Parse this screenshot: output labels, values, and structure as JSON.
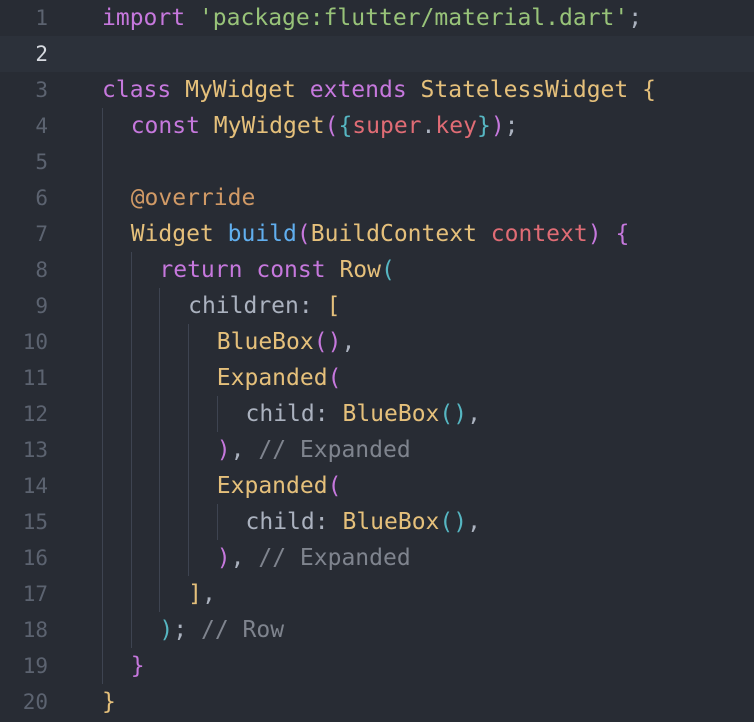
{
  "editor": {
    "lines": [
      {
        "num": "1",
        "t": [
          "import",
          " ",
          "'package:flutter/material.dart'",
          ";"
        ]
      },
      {
        "num": "2",
        "t": []
      },
      {
        "num": "3",
        "t": [
          "class",
          " ",
          "MyWidget",
          " ",
          "extends",
          " ",
          "StatelessWidget",
          " ",
          "{"
        ]
      },
      {
        "num": "4",
        "t": [
          "const",
          " ",
          "MyWidget",
          "(",
          "{",
          "super",
          ".",
          "key",
          "}",
          ")",
          ";"
        ]
      },
      {
        "num": "5",
        "t": []
      },
      {
        "num": "6",
        "t": [
          "@override"
        ]
      },
      {
        "num": "7",
        "t": [
          "Widget",
          " ",
          "build",
          "(",
          "BuildContext",
          " ",
          "context",
          ")",
          " ",
          "{"
        ]
      },
      {
        "num": "8",
        "t": [
          "return",
          " ",
          "const",
          " ",
          "Row",
          "("
        ]
      },
      {
        "num": "9",
        "t": [
          "children",
          ":",
          " ",
          "["
        ]
      },
      {
        "num": "10",
        "t": [
          "BlueBox",
          "(",
          ")",
          ","
        ]
      },
      {
        "num": "11",
        "t": [
          "Expanded",
          "("
        ]
      },
      {
        "num": "12",
        "t": [
          "child",
          ":",
          " ",
          "BlueBox",
          "(",
          ")",
          ","
        ]
      },
      {
        "num": "13",
        "t": [
          ")",
          ",",
          " ",
          "// Expanded"
        ]
      },
      {
        "num": "14",
        "t": [
          "Expanded",
          "("
        ]
      },
      {
        "num": "15",
        "t": [
          "child",
          ":",
          " ",
          "BlueBox",
          "(",
          ")",
          ","
        ]
      },
      {
        "num": "16",
        "t": [
          ")",
          ",",
          " ",
          "// Expanded"
        ]
      },
      {
        "num": "17",
        "t": [
          "]",
          ","
        ]
      },
      {
        "num": "18",
        "t": [
          ")",
          ";",
          " ",
          "// Row"
        ]
      },
      {
        "num": "19",
        "t": [
          "}"
        ]
      },
      {
        "num": "20",
        "t": [
          "}"
        ]
      }
    ]
  }
}
